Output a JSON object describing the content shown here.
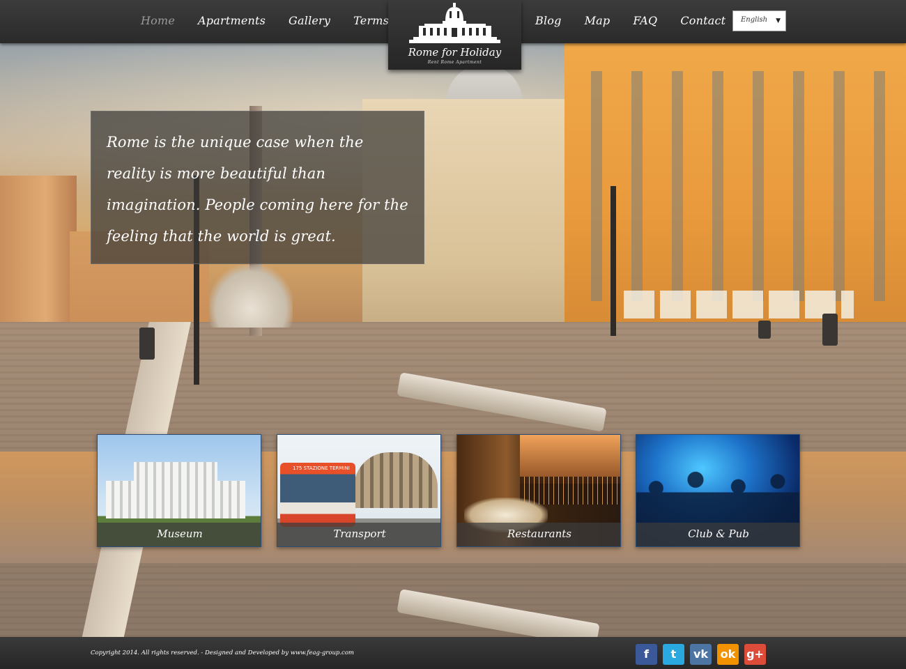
{
  "nav": {
    "left": [
      {
        "label": "Home",
        "active": true
      },
      {
        "label": "Apartments"
      },
      {
        "label": "Gallery"
      },
      {
        "label": "Terms"
      }
    ],
    "right": [
      {
        "label": "Blog"
      },
      {
        "label": "Map"
      },
      {
        "label": "FAQ"
      },
      {
        "label": "Contact"
      }
    ],
    "language": "English"
  },
  "logo": {
    "title": "Rome for Holiday",
    "subtitle": "Rent Rome Apartment"
  },
  "quote": "Rome is the unique case when the reality is more beautiful than imagination. People coming here for the feeling that the world is great.",
  "tiles": [
    {
      "caption": "Museum"
    },
    {
      "caption": "Transport",
      "bus_sign": "175 STAZIONE TERMINI"
    },
    {
      "caption": "Restaurants"
    },
    {
      "caption": "Club & Pub"
    }
  ],
  "footer": {
    "copyright": "Copyright 2014. All rights reserved. - Designed and Developed by www.feag-group.com",
    "social": [
      {
        "icon": "facebook-icon",
        "glyph": "f",
        "color": "#3b5998"
      },
      {
        "icon": "twitter-icon",
        "glyph": "t",
        "color": "#2aa9e0"
      },
      {
        "icon": "vk-icon",
        "glyph": "vk",
        "color": "#4c75a3"
      },
      {
        "icon": "odnoklassniki-icon",
        "glyph": "ok",
        "color": "#f39200"
      },
      {
        "icon": "google-plus-icon",
        "glyph": "g+",
        "color": "#dd4b39"
      }
    ]
  }
}
